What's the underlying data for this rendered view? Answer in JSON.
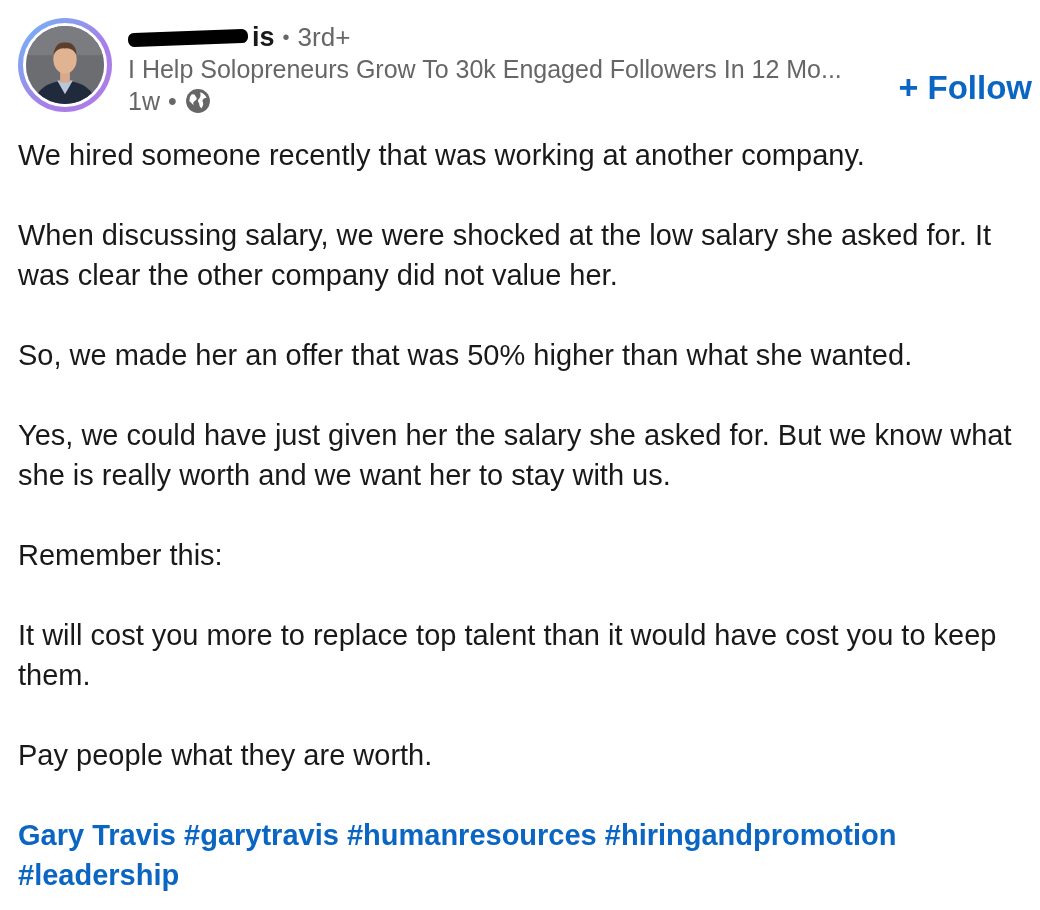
{
  "author": {
    "name": "is",
    "redacted": true,
    "degree": "3rd+",
    "headline": "I Help Solopreneurs Grow To 30k Engaged Followers In 12 Mo...",
    "time": "1w",
    "separator": "•"
  },
  "follow_button": {
    "icon": "+",
    "label": "Follow"
  },
  "paragraphs": [
    "We hired someone recently that was working at another company.",
    "When discussing salary, we were shocked at the low salary she asked for. It was clear the other company did not value her.",
    "So, we made her an offer that was 50% higher than what she wanted.",
    "Yes, we could have just given her the salary she asked for. But we know what she is really worth and we want her to stay with us.",
    "Remember this:",
    "It will cost you more to replace top talent than it would have cost you to keep them.",
    "Pay people what they are worth."
  ],
  "tags": [
    "Gary Travis",
    "#garytravis",
    "#humanresources",
    "#hiringandpromotion",
    "#leadership"
  ]
}
